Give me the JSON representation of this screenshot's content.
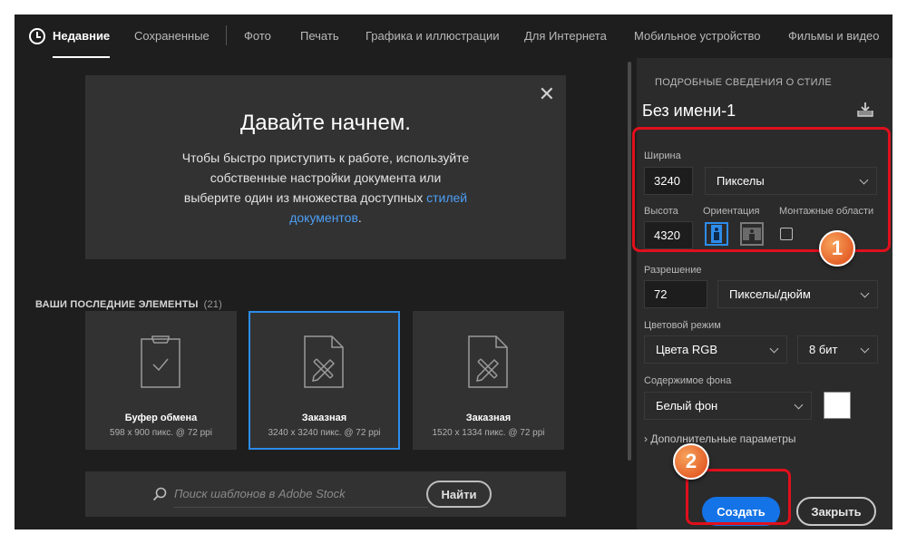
{
  "tabs": [
    {
      "label": "Недавние",
      "active": true
    },
    {
      "label": "Сохраненные"
    },
    {
      "label": "Фото"
    },
    {
      "label": "Печать"
    },
    {
      "label": "Графика и иллюстрации"
    },
    {
      "label": "Для Интернета"
    },
    {
      "label": "Мобильное устройство"
    },
    {
      "label": "Фильмы и видео"
    }
  ],
  "welcome": {
    "title": "Давайте начнем.",
    "body": "Чтобы быстро приступить к работе, используйте собственные настройки документа или выберите один из множества доступных ",
    "link": "стилей документов",
    "end": "."
  },
  "recent": {
    "title": "ВАШИ ПОСЛЕДНИЕ ЭЛЕМЕНТЫ",
    "count": "(21)",
    "cards": [
      {
        "title": "Буфер обмена",
        "subtitle": "598 x 900 пикс. @ 72 ppi",
        "icon": "clipboard-icon"
      },
      {
        "title": "Заказная",
        "subtitle": "3240 x 3240 пикс. @ 72 ppi",
        "icon": "custom-document-icon",
        "selected": true
      },
      {
        "title": "Заказная",
        "subtitle": "1520 x 1334 пикс. @ 72 ppi",
        "icon": "custom-document-icon"
      }
    ]
  },
  "search": {
    "placeholder": "Поиск шаблонов в Adobe Stock",
    "button": "Найти"
  },
  "panel": {
    "title": "ПОДРОБНЫЕ СВЕДЕНИЯ О СТИЛЕ",
    "doc_name": "Без имени-1",
    "width_label": "Ширина",
    "width_value": "3240",
    "width_unit": "Пикселы",
    "height_label": "Высота",
    "height_value": "4320",
    "orientation_label": "Ориентация",
    "orientation": "portrait",
    "artboards_label": "Монтажные области",
    "artboards_checked": false,
    "resolution_label": "Разрешение",
    "resolution_value": "72",
    "resolution_unit": "Пикселы/дюйм",
    "color_mode_label": "Цветовой режим",
    "color_mode": "Цвета RGB",
    "bit_depth": "8 бит",
    "background_label": "Содержимое фона",
    "background": "Белый фон",
    "background_color": "#ffffff",
    "advanced": "Дополнительные параметры",
    "create": "Создать",
    "close": "Закрыть"
  },
  "annotations": [
    "1",
    "2"
  ],
  "colors": {
    "accent": "#1473e6",
    "selection": "#2d8ceb",
    "annotation": "#e0101c",
    "badge": "#e5622a"
  }
}
